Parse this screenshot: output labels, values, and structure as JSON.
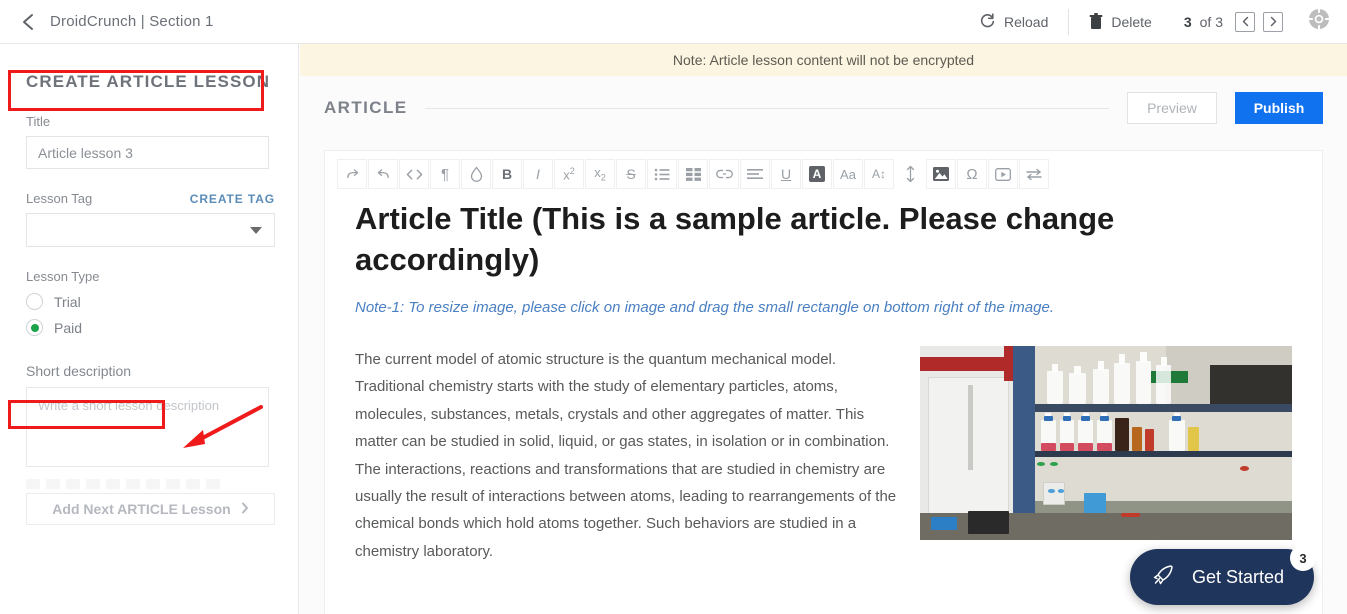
{
  "topbar": {
    "back_icon": "chevron-left-icon",
    "breadcrumb": "DroidCrunch  |  Section 1",
    "reload_label": "Reload",
    "reload_icon": "refresh-icon",
    "delete_label": "Delete",
    "delete_icon": "trash-icon",
    "pager": {
      "current": "3",
      "of_text": "of 3",
      "prev_icon": "chevron-left-icon",
      "next_icon": "chevron-right-icon"
    },
    "help_icon": "lifebuoy-help-icon"
  },
  "left_panel": {
    "title": "CREATE ARTICLE LESSON",
    "title_label": "Title",
    "title_value": "Article lesson 3",
    "title_placeholder": "Article lesson 3",
    "lesson_tag_label": "Lesson Tag",
    "create_tag_label": "CREATE TAG",
    "lesson_tag_value": "",
    "lesson_type_label": "Lesson Type",
    "lesson_types": [
      {
        "label": "Trial",
        "selected": false
      },
      {
        "label": "Paid",
        "selected": true
      }
    ],
    "short_description_label": "Short description",
    "short_description_value": "",
    "short_description_placeholder": "Write a short lesson description",
    "add_next_label": "Add Next ARTICLE Lesson",
    "add_next_icon": "chevron-right-icon",
    "selected_radio_color": "#1aa34a"
  },
  "annotations": {
    "box_title": "CREATE ARTICLE LESSON",
    "box_short_desc": "Short description",
    "arrow_target": "short-description-textarea",
    "color": "#ef1b1b"
  },
  "main": {
    "note_banner": "Note: Article lesson content will not be encrypted",
    "section_title": "ARTICLE",
    "preview_label": "Preview",
    "publish_label": "Publish",
    "publish_color": "#1172f0",
    "toolbar": [
      {
        "name": "redo-icon",
        "glyph": "↷"
      },
      {
        "name": "undo-icon",
        "glyph": "↶"
      },
      {
        "name": "code-icon",
        "glyph": "<>"
      },
      {
        "name": "paragraph-icon",
        "glyph": "¶"
      },
      {
        "name": "clear-format-droplet-icon",
        "glyph": "◇"
      },
      {
        "name": "bold-icon",
        "glyph": "B"
      },
      {
        "name": "italic-icon",
        "glyph": "I"
      },
      {
        "name": "superscript-icon",
        "glyph": "x²"
      },
      {
        "name": "subscript-icon",
        "glyph": "x₂"
      },
      {
        "name": "strikethrough-icon",
        "glyph": "S"
      },
      {
        "name": "bullet-list-icon",
        "glyph": "≔"
      },
      {
        "name": "table-icon",
        "glyph": "▤"
      },
      {
        "name": "link-icon",
        "glyph": "🔗"
      },
      {
        "name": "align-icon",
        "glyph": "≡"
      },
      {
        "name": "underline-icon",
        "glyph": "U"
      },
      {
        "name": "text-color-icon",
        "glyph": "A"
      },
      {
        "name": "font-family-icon",
        "glyph": "Aa"
      },
      {
        "name": "font-size-icon",
        "glyph": "A↕"
      },
      {
        "name": "line-height-icon",
        "glyph": "↕"
      },
      {
        "name": "insert-image-icon",
        "glyph": "▣"
      },
      {
        "name": "special-character-icon",
        "glyph": "Ω"
      },
      {
        "name": "insert-video-icon",
        "glyph": "▶"
      },
      {
        "name": "horizontal-rule-icon",
        "glyph": "⇆"
      }
    ],
    "article": {
      "heading": "Article Title (This is a sample article. Please change accordingly)",
      "note": "Note-1: To resize image, please click on image and drag the small rectangle on bottom right of the image.",
      "note_color": "#4a7fc1",
      "paragraph": "The current model of atomic structure is the quantum mechanical model. Traditional chemistry starts with the study of elementary particles, atoms, molecules, substances, metals, crystals and other aggregates of matter. This matter can be studied in solid, liquid, or gas states, in isolation or in combination. The interactions, reactions and transformations that are studied in chemistry are usually the result of interactions between atoms, leading to rearrangements of the chemical bonds which hold atoms together. Such behaviors are studied in a chemistry laboratory.",
      "image_alt": "chemistry-laboratory-photo"
    }
  },
  "widget": {
    "label": "Get Started",
    "badge": "3",
    "icon": "rocket-icon",
    "color": "#1f355c"
  }
}
